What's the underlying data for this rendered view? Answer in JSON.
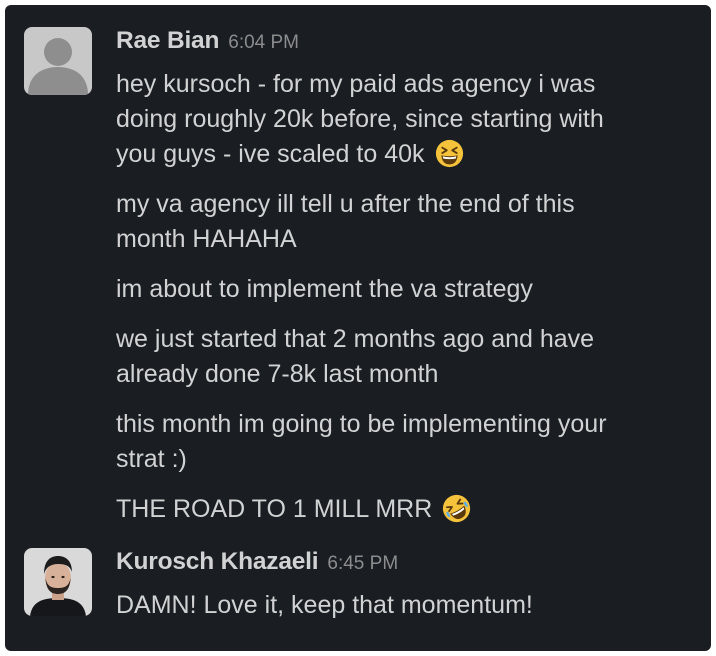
{
  "messages": [
    {
      "sender": "Rae Bian",
      "time": "6:04 PM",
      "avatar_icon": "default-user-avatar-icon",
      "blocks": [
        {
          "lines": [
            "hey kursoch - for my paid ads agency i was",
            "doing roughly 20k before, since starting with",
            "you guys - ive scaled to 40k"
          ],
          "emoji": "grinning-squinting-face-icon"
        },
        {
          "lines": [
            "my va agency ill tell u after the end of this",
            "month HAHAHA"
          ]
        },
        {
          "lines": [
            "im about to implement the va strategy"
          ]
        },
        {
          "lines": [
            "we just started that 2 months ago and have",
            "already done 7-8k last month"
          ]
        },
        {
          "lines": [
            "this month im going to be implementing your",
            "strat :)"
          ]
        },
        {
          "lines": [
            "THE ROAD TO 1 MILL MRR"
          ],
          "emoji": "rolling-on-floor-laughing-icon"
        }
      ]
    },
    {
      "sender": "Kurosch Khazaeli",
      "time": "6:45 PM",
      "avatar_icon": "profile-photo-avatar",
      "blocks": [
        {
          "lines": [
            "DAMN! Love it, keep that momentum!"
          ]
        }
      ]
    }
  ],
  "colors": {
    "background": "#1a1d21",
    "text": "#d1d2d3",
    "timestamp": "#8b8c8e",
    "emoji": "#f5c33b"
  }
}
